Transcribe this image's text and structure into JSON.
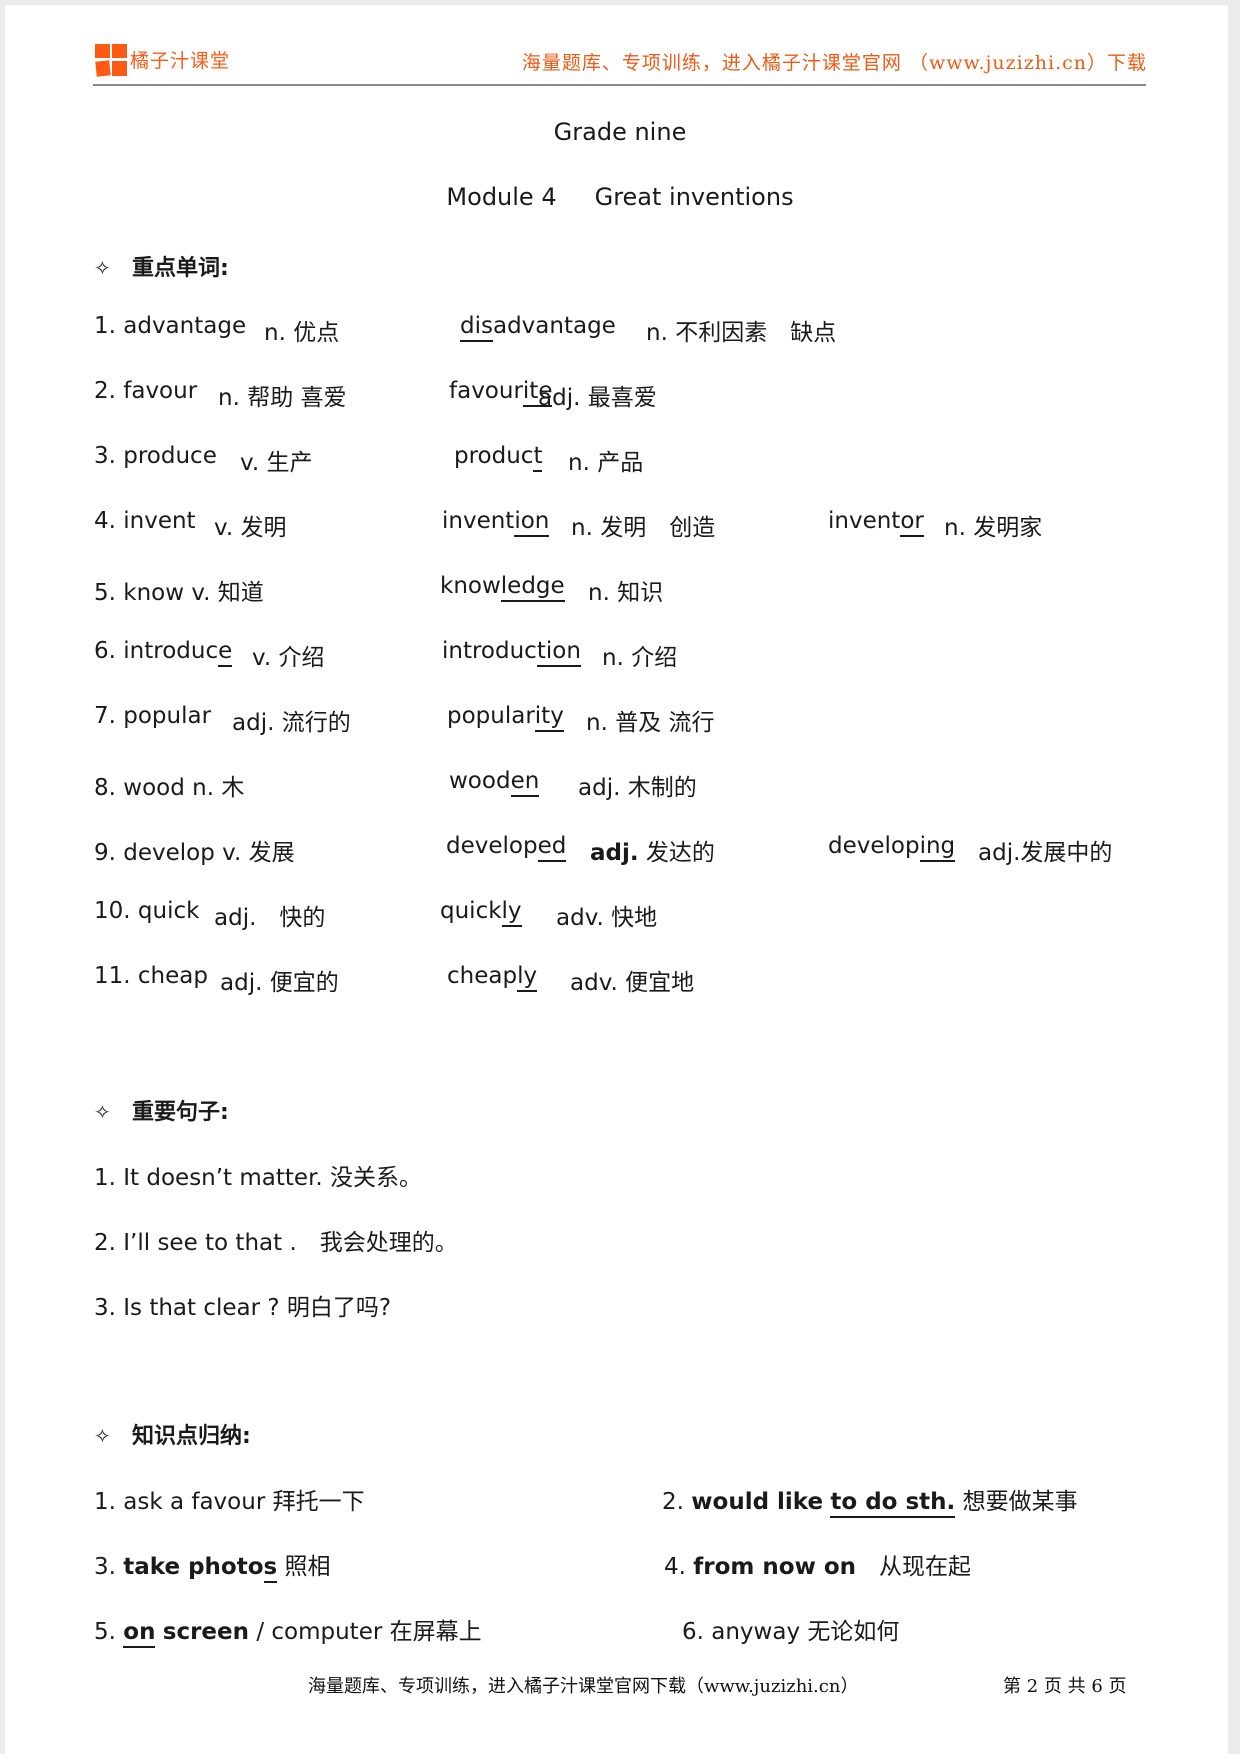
{
  "header": {
    "brand": "橘子汁课堂",
    "slogan": "海量题库、专项训练，进入橘子汁课堂官网 （www.juzizhi.cn）下载",
    "brand_color": "#ff5a14"
  },
  "titles": {
    "grade": "Grade nine",
    "module_no": "Module 4",
    "module_name": "Great inventions"
  },
  "sections": {
    "vocab": {
      "bullet": "✧",
      "heading": "重点单词:"
    },
    "sentences": {
      "bullet": "✧",
      "heading": "重要句子:"
    },
    "phrases": {
      "bullet": "✧",
      "heading": "知识点归纳:"
    }
  },
  "vocab": [
    {
      "base": "1. advantage",
      "base_pos": "n. 优点",
      "d1_pre": "",
      "d1_ul": "dis",
      "d1_post": "advantage",
      "d1_pos": "n. 不利因素　缺点"
    },
    {
      "base": "2. favour",
      "base_pos": "n. 帮助  喜爱",
      "d1_pre": "favour",
      "d1_ul": "ite",
      "d1_post": "",
      "d1_pos": "adj.  最喜爱"
    },
    {
      "base": "3. produce",
      "base_pos": "v. 生产",
      "d1_pre": "produc",
      "d1_ul": "t",
      "d1_post": "",
      "d1_pos": "n. 产品"
    },
    {
      "base": "4. invent",
      "base_pos": "v. 发明",
      "d1_pre": "invent",
      "d1_ul": "ion",
      "d1_post": "",
      "d1_pos": "n. 发明　创造",
      "d2_pre": "invent",
      "d2_ul": "or",
      "d2_pos": "n. 发明家"
    },
    {
      "base": "5. know v. 知道",
      "base_pos": "",
      "d1_pre": "know",
      "d1_ul": "ledge",
      "d1_post": "",
      "d1_pos": "n. 知识"
    },
    {
      "base": "6. introduc",
      "base_ul": "e",
      "base_pos": "v. 介绍",
      "d1_pre": "introduc",
      "d1_ul": "tion",
      "d1_post": "",
      "d1_pos": "n. 介绍"
    },
    {
      "base": "7. popular",
      "base_pos": "adj. 流行的",
      "d1_pre": "popular",
      "d1_ul": "ity",
      "d1_post": "",
      "d1_pos": "n. 普及  流行"
    },
    {
      "base": "8. wood n. 木",
      "base_pos": "",
      "d1_pre": "wood",
      "d1_ul": "en",
      "d1_post": "",
      "d1_pos": "adj. 木制的"
    },
    {
      "base": "9. develop v. 发展",
      "base_pos": "",
      "d1_pre": "develop",
      "d1_ul": "ed",
      "d1_post": "",
      "d1_pos_bold": "adj.",
      "d1_pos": "发达的",
      "d2_pre": "develop",
      "d2_ul": "ing",
      "d2_pos": "adj.发展中的"
    },
    {
      "base": "10. quick",
      "base_pos": "adj.　快的",
      "d1_pre": "quick",
      "d1_ul": "ly",
      "d1_post": "",
      "d1_pos": "adv. 快地"
    },
    {
      "base": "11. cheap",
      "base_pos": "adj. 便宜的",
      "d1_pre": "cheap",
      "d1_ul": "ly",
      "d1_post": "",
      "d1_pos": "adv. 便宜地"
    }
  ],
  "sentences": [
    "1. It doesn’t matter. 没关系。",
    "2. I’ll see to that .　我会处理的。",
    "3. Is that clear ?  明白了吗?"
  ],
  "phrases": {
    "p1": {
      "text": "1. ask a favour  拜托一下"
    },
    "p2": {
      "num": "2.",
      "bold": "would like",
      "ul": "to do sth.",
      "cn": "想要做某事"
    },
    "p3": {
      "num": "3.",
      "bold": "take photo",
      "ul": "s",
      "cn": "照相"
    },
    "p4": {
      "num": "4.",
      "bold": "from now on",
      "cn": "从现在起"
    },
    "p5": {
      "num": "5.",
      "ul": "on",
      "bold": "screen",
      "rest": "/ computer 在屏幕上"
    },
    "p6": {
      "text": "6. anyway  无论如何"
    }
  },
  "footer": {
    "slogan": "海量题库、专项训练，进入橘子汁课堂官网下载（www.juzizhi.cn）",
    "page_info": "第 2 页 共 6 页"
  }
}
